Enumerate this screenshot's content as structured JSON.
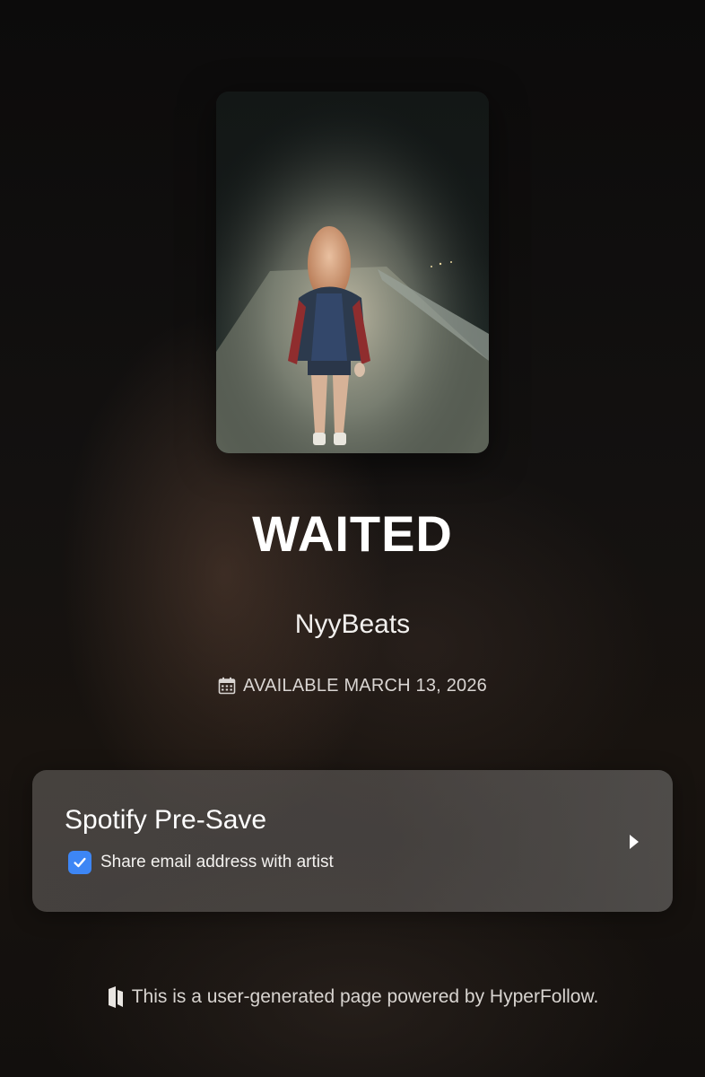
{
  "release": {
    "title": "WAITED",
    "artist": "NyyBeats",
    "availability": "AVAILABLE MARCH 13, 2026"
  },
  "cover": {
    "image": "night-photo-person-on-road"
  },
  "presave": {
    "service_label": "Spotify Pre-Save",
    "checkbox_label": "Share email address with artist",
    "checkbox_checked": true
  },
  "footer": {
    "text": "This is a user-generated page powered by HyperFollow."
  },
  "icons": {
    "calendar": "calendar-icon",
    "check": "check-icon",
    "chevron": "chevron-right-icon",
    "hyperfollow": "hyperfollow-logo-icon"
  },
  "colors": {
    "checkbox": "#3d86f5",
    "text": "#ffffff"
  }
}
